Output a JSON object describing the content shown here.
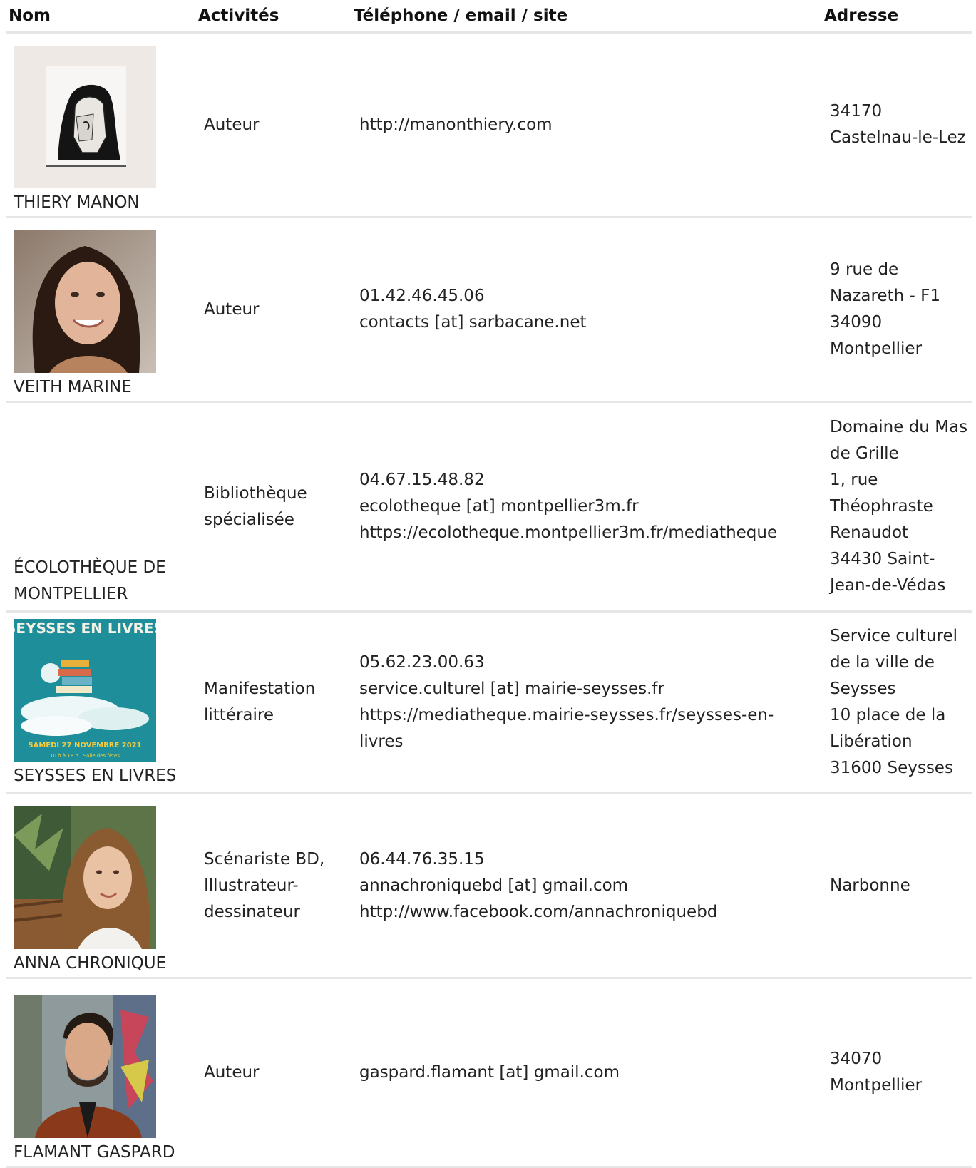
{
  "header": {
    "col_name": "Nom",
    "col_activities": "Activités",
    "col_contact": "Téléphone / email / site",
    "col_address": "Adresse"
  },
  "rows": [
    {
      "name": "THIERY MANON",
      "photo_icon": "portrait-drawing-image",
      "activities": [
        "Auteur"
      ],
      "contact": [
        "http://manonthiery.com"
      ],
      "address": [
        "34170",
        "Castelnau-le-Lez"
      ]
    },
    {
      "name": "VEITH MARINE",
      "photo_icon": "portrait-photo-image",
      "activities": [
        "Auteur"
      ],
      "contact": [
        "01.42.46.45.06",
        "contacts [at] sarbacane.net"
      ],
      "address": [
        "9 rue de",
        "Nazareth - F1",
        "34090",
        "Montpellier"
      ]
    },
    {
      "name_lines": [
        "ÉCOLOTHÈQUE DE",
        "MONTPELLIER"
      ],
      "activities": [
        "Bibliothèque",
        "spécialisée"
      ],
      "contact": [
        "04.67.15.48.82",
        "ecolotheque [at] montpellier3m.fr",
        "https://ecolotheque.montpellier3m.fr/mediatheque"
      ],
      "address": [
        "Domaine du Mas",
        "de Grille",
        "1, rue",
        "Théophraste",
        "Renaudot",
        "34430 Saint-",
        "Jean-de-Védas"
      ]
    },
    {
      "name": "SEYSSES EN LIVRES",
      "photo_icon": "event-poster-image",
      "poster_title": "SEYSSES EN LIVRES",
      "poster_date": "SAMEDI 27 NOVEMBRE 2021",
      "poster_sub": "10 h à 18 h | Salle des fêtes",
      "activities": [
        "Manifestation",
        "littéraire"
      ],
      "contact": [
        "05.62.23.00.63",
        "service.culturel [at] mairie-seysses.fr",
        "https://mediatheque.mairie-seysses.fr/seysses-en-",
        "livres"
      ],
      "address": [
        "Service culturel",
        "de la ville de",
        "Seysses",
        "10 place de la",
        "Libération",
        "31600 Seysses"
      ]
    },
    {
      "name": "ANNA CHRONIQUE",
      "photo_icon": "portrait-photo-image",
      "activities": [
        "Scénariste BD,",
        "Illustrateur-",
        "dessinateur"
      ],
      "contact": [
        "06.44.76.35.15",
        "annachroniquebd [at] gmail.com",
        "http://www.facebook.com/annachroniquebd"
      ],
      "address": [
        "Narbonne"
      ]
    },
    {
      "name": "FLAMANT GASPARD",
      "photo_icon": "portrait-photo-image",
      "activities": [
        "Auteur"
      ],
      "contact": [
        "gaspard.flamant [at] gmail.com"
      ],
      "address": [
        "34070",
        "Montpellier"
      ]
    }
  ]
}
